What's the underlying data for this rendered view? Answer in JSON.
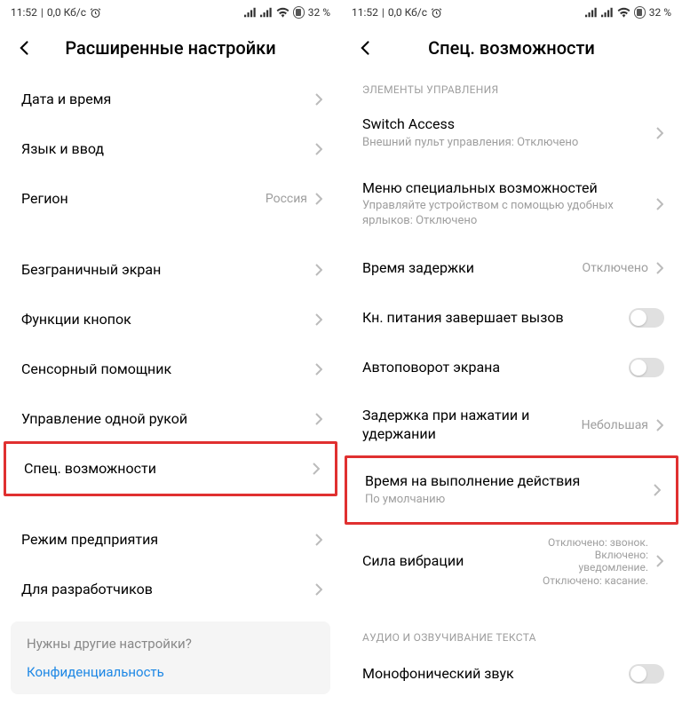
{
  "status": {
    "time": "11:52",
    "net": "0,0 Кб/с",
    "battery": "32 %"
  },
  "left": {
    "title": "Расширенные настройки",
    "items": [
      {
        "title": "Дата и время"
      },
      {
        "title": "Язык и ввод"
      },
      {
        "title": "Регион",
        "value": "Россия"
      }
    ],
    "items2": [
      {
        "title": "Безграничный экран"
      },
      {
        "title": "Функции кнопок"
      },
      {
        "title": "Сенсорный помощник"
      },
      {
        "title": "Управление одной рукой"
      }
    ],
    "highlight": {
      "title": "Спец. возможности"
    },
    "items3": [
      {
        "title": "Режим предприятия"
      },
      {
        "title": "Для разработчиков"
      }
    ],
    "footer": {
      "question": "Нужны другие настройки?",
      "link": "Конфиденциальность"
    }
  },
  "right": {
    "title": "Спец. возможности",
    "section1": "ЭЛЕМЕНТЫ УПРАВЛЕНИЯ",
    "items": [
      {
        "title": "Switch Access",
        "sub": "Внешний пульт управления: Отключено"
      },
      {
        "title": "Меню специальных возможностей",
        "sub": "Управляйте устройством с помощью удобных ярлыков: Отключено"
      },
      {
        "title": "Время задержки",
        "value": "Отключено"
      }
    ],
    "toggles": [
      {
        "title": "Кн. питания завершает вызов"
      },
      {
        "title": "Автоповорот экрана"
      }
    ],
    "delay": {
      "title": "Задержка при нажатии и удержании",
      "value": "Небольшая"
    },
    "highlight": {
      "title": "Время на выполнение действия",
      "sub": "По умолчанию"
    },
    "vibration": {
      "title": "Сила вибрации",
      "value": "Отключено: звонок. Включено: уведомление. Отключено: касание."
    },
    "section2": "АУДИО И ОЗВУЧИВАНИЕ ТЕКСТА",
    "mono": {
      "title": "Монофонический звук"
    }
  }
}
